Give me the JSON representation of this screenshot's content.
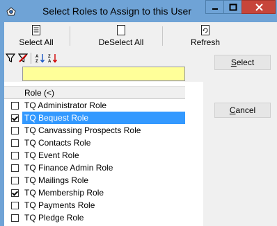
{
  "window": {
    "title": "Select Roles to Assign to this User"
  },
  "toolbar": {
    "select_all_label": "Select All",
    "deselect_all_label": "DeSelect All",
    "refresh_label": "Refresh"
  },
  "grid": {
    "column_header": "Role (<)",
    "filter_value": "",
    "rows": [
      {
        "label": "TQ Administrator Role",
        "checked": false,
        "selected": false
      },
      {
        "label": "TQ Bequest Role",
        "checked": true,
        "selected": true
      },
      {
        "label": "TQ Canvassing Prospects Role",
        "checked": false,
        "selected": false
      },
      {
        "label": "TQ Contacts Role",
        "checked": false,
        "selected": false
      },
      {
        "label": "TQ Event Role",
        "checked": false,
        "selected": false
      },
      {
        "label": "TQ Finance Admin Role",
        "checked": false,
        "selected": false
      },
      {
        "label": "TQ Mailings Role",
        "checked": false,
        "selected": false
      },
      {
        "label": "TQ Membership Role",
        "checked": true,
        "selected": false
      },
      {
        "label": "TQ Payments Role",
        "checked": false,
        "selected": false
      },
      {
        "label": "TQ Pledge Role",
        "checked": false,
        "selected": false
      }
    ]
  },
  "buttons": {
    "select_first": "S",
    "select_rest": "elect",
    "cancel_first": "C",
    "cancel_rest": "ancel"
  },
  "colors": {
    "titlebar": "#6fa3d6",
    "close_button": "#c7453a",
    "selected_row": "#3399ff",
    "filter_cell": "#ffff99"
  }
}
